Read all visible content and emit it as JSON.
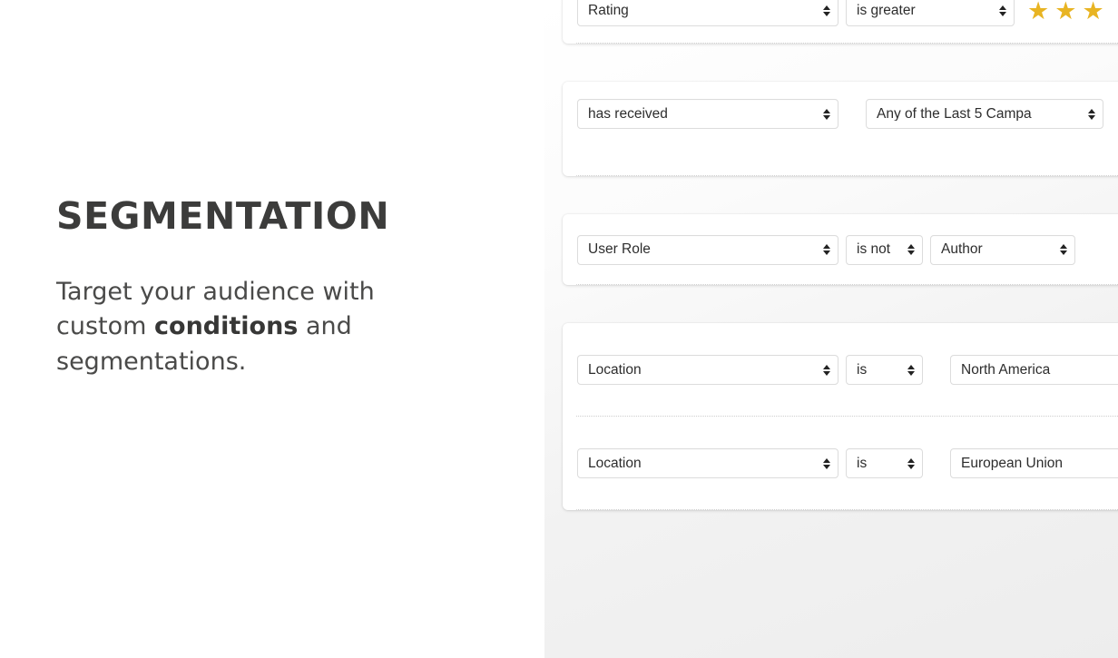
{
  "promo": {
    "title": "SEGMENTATION",
    "body_prefix": "Target your audience with custom ",
    "body_bold": "conditions",
    "body_suffix": " and segmentations."
  },
  "colors": {
    "star_gold": "#e8b423",
    "heading": "#3c3c3b",
    "body_text": "#4a4a49",
    "panel_bg": "#f1f1f1",
    "card_bg": "#ffffff",
    "control_border": "#dcdcdc",
    "divider": "#cdcdcd"
  },
  "conditions": [
    {
      "card_id": "rating-condition-card",
      "rows": [
        {
          "field": {
            "value": "Rating",
            "type": "select"
          },
          "operator": {
            "value": "is greater",
            "type": "select"
          },
          "value_stars": {
            "count": 3,
            "glyph": "★"
          }
        }
      ]
    },
    {
      "card_id": "campaign-condition-card",
      "rows": [
        {
          "field": {
            "value": "has received",
            "type": "select"
          },
          "value": {
            "value": "Any of the Last 5 Campa",
            "type": "select"
          }
        }
      ]
    },
    {
      "card_id": "user-role-condition-card",
      "rows": [
        {
          "field": {
            "value": "User Role",
            "type": "select"
          },
          "operator": {
            "value": "is not",
            "type": "select"
          },
          "value": {
            "value": "Author",
            "type": "select"
          }
        }
      ]
    },
    {
      "card_id": "location-condition-card",
      "rows": [
        {
          "field": {
            "value": "Location",
            "type": "select"
          },
          "operator": {
            "value": "is",
            "type": "select"
          },
          "value": {
            "value": "North America",
            "type": "input"
          }
        },
        {
          "field": {
            "value": "Location",
            "type": "select"
          },
          "operator": {
            "value": "is",
            "type": "select"
          },
          "value": {
            "value": "European Union",
            "type": "input"
          }
        }
      ]
    }
  ]
}
